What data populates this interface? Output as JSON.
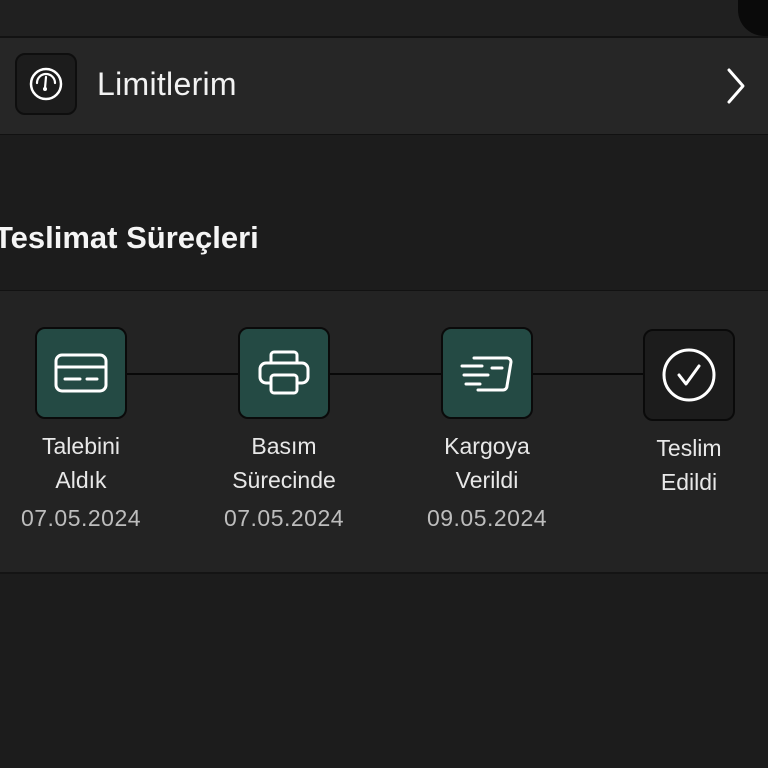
{
  "limits": {
    "label": "Limitlerim",
    "icon": "gauge-icon",
    "chevron_icon": "chevron-right-icon"
  },
  "delivery": {
    "title": "Teslimat Süreçleri",
    "steps": [
      {
        "line1": "Talebini",
        "line2": "Aldık",
        "date": "07.05.2024",
        "icon": "credit-card-icon",
        "status": "done"
      },
      {
        "line1": "Basım",
        "line2": "Sürecinde",
        "date": "07.05.2024",
        "icon": "printer-icon",
        "status": "done"
      },
      {
        "line1": "Kargoya",
        "line2": "Verildi",
        "date": "09.05.2024",
        "icon": "shipping-card-icon",
        "status": "done"
      },
      {
        "line1": "Teslim",
        "line2": "Edildi",
        "date": "",
        "icon": "check-circle-icon",
        "status": "pending"
      }
    ]
  },
  "colors": {
    "background": "#1c1c1c",
    "panel": "#262626",
    "step_done": "#244a44",
    "step_pending": "#1c1c1c",
    "text": "#ffffff"
  }
}
